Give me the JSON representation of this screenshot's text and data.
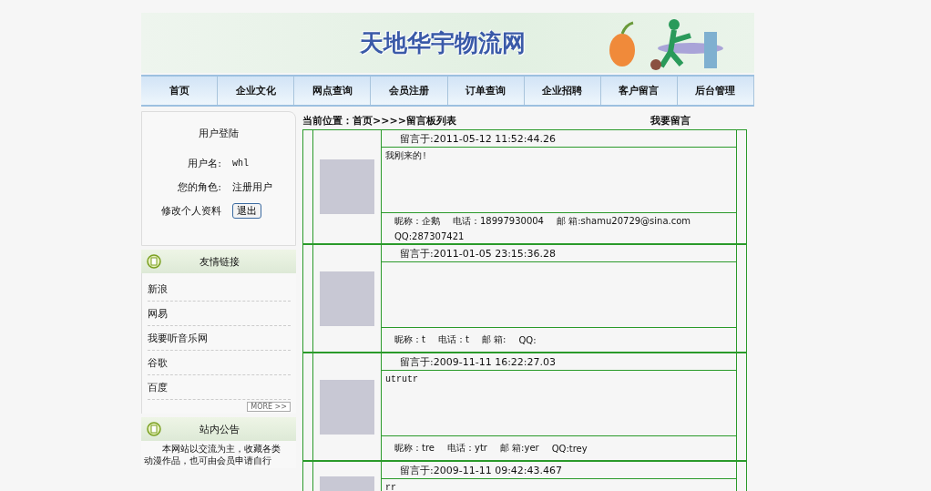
{
  "header": {
    "title": "天地华宇物流网"
  },
  "nav": [
    {
      "label": "首页"
    },
    {
      "label": "企业文化"
    },
    {
      "label": "网点查询"
    },
    {
      "label": "会员注册"
    },
    {
      "label": "订单查询"
    },
    {
      "label": "企业招聘"
    },
    {
      "label": "客户留言"
    },
    {
      "label": "后台管理"
    }
  ],
  "login": {
    "title": "用户登陆",
    "username_label": "用户名:",
    "username": "whl",
    "role_label": "您的角色:",
    "role": "注册用户",
    "profile_link": "修改个人资料",
    "logout_button": "退出"
  },
  "links": {
    "title": "友情链接",
    "items": [
      "新浪",
      "网易",
      "我要听音乐网",
      "谷歌",
      "百度"
    ],
    "more": "MORE >>"
  },
  "notice": {
    "title": "站内公告",
    "lines": [
      "本网站以交流为主，收藏各类",
      "动漫作品，也可由会员申请自行"
    ]
  },
  "breadcrumb": "当前位置：首页>>>>留言板列表",
  "post_link": "我要留言",
  "messages": [
    {
      "time": "留言于:2011-05-12 11:52:44.26",
      "content": "我刚来的!",
      "nickname": "昵称：企鹅",
      "phone": "电话：18997930004",
      "email": "邮 箱:shamu20729@sina.com",
      "qq": "QQ:287307421"
    },
    {
      "time": "留言于:2011-01-05 23:15:36.28",
      "nickname": "昵称：t",
      "phone": "电话：t",
      "email": "邮 箱:",
      "qq": "QQ:"
    },
    {
      "time": "留言于:2009-11-11 16:22:27.03",
      "content": "utrutr",
      "nickname": "昵称：tre",
      "phone": "电话：ytr",
      "email": "邮 箱:yer",
      "qq": "QQ:trey"
    },
    {
      "time": "留言于:2009-11-11 09:42:43.467",
      "content": "rr"
    }
  ]
}
